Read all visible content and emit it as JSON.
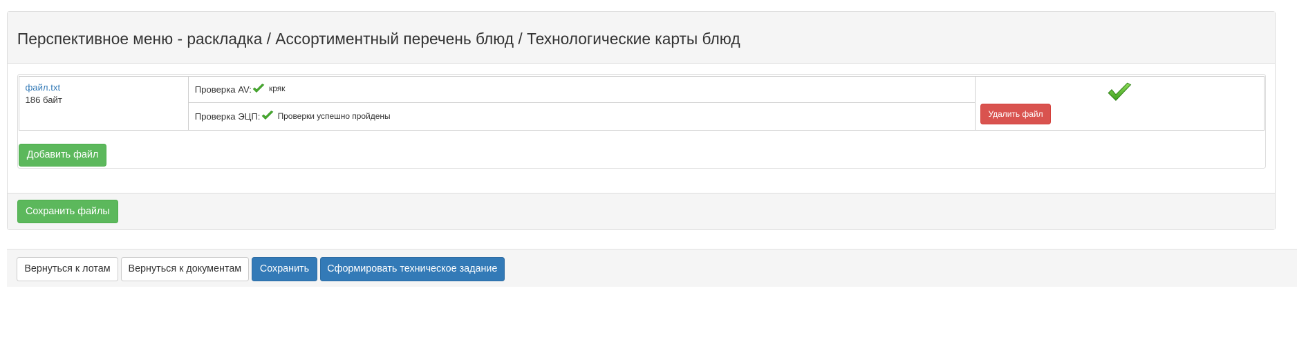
{
  "panel": {
    "title": "Перспективное меню - раскладка / Ассортиментный перечень блюд / Технологические карты блюд"
  },
  "file": {
    "name": "файл.txt",
    "size": "186 байт",
    "av_check_label": "Проверка AV:",
    "av_check_result": "кряк",
    "ecp_check_label": "Проверка ЭЦП:",
    "ecp_check_result": "Проверки успешно пройдены",
    "delete_label": "Удалить файл"
  },
  "buttons": {
    "add_file": "Добавить файл",
    "save_files": "Сохранить файлы",
    "back_to_lots": "Вернуться к лотам",
    "back_to_documents": "Вернуться к документам",
    "save": "Сохранить",
    "generate_tz": "Сформировать техническое задание"
  },
  "icons": {
    "check": "check-icon",
    "status": "check-icon"
  },
  "colors": {
    "success": "#5cb85c",
    "danger": "#d9534f",
    "primary": "#337ab7",
    "link": "#337ab7",
    "check": "#4caf30"
  }
}
